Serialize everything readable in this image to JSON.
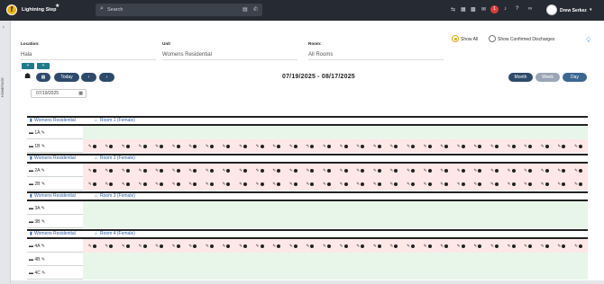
{
  "app": {
    "brand": "Lightning Step",
    "star": "★"
  },
  "search": {
    "placeholder": "Search"
  },
  "topbar": {
    "badge_count": "1",
    "user_name": "Drew Serkez"
  },
  "sidebar": {
    "arrow": "‹",
    "vertical_label": "HOMEPAGE"
  },
  "filters": {
    "location_label": "Location:",
    "location_value": "Hala",
    "unit_label": "Unit",
    "unit_value": "Womens Residential",
    "room_label": "Room:",
    "room_value": "All Rooms",
    "show_all": "Show All",
    "show_confirmed": "Show Confirmed Discharges",
    "selected": "show_all"
  },
  "add_buttons": [
    "+",
    "+"
  ],
  "toolbar": {
    "today": "Today",
    "prev": "‹",
    "next": "›",
    "range": "07/19/2025 - 08/17/2025",
    "views": [
      "Month",
      "Week",
      "Day"
    ],
    "active_view": "Month",
    "date_input": "07/19/2025"
  },
  "units": [
    {
      "unit": "Womens Residential",
      "room": "Room 1 (Female)",
      "beds": [
        {
          "label": "1A",
          "occupied": false
        },
        {
          "label": "1B",
          "occupied": true
        }
      ]
    },
    {
      "unit": "Womens Residential",
      "room": "Room 2 (Female)",
      "beds": [
        {
          "label": "2A",
          "occupied": true
        },
        {
          "label": "2B",
          "occupied": true
        }
      ]
    },
    {
      "unit": "Womens Residential",
      "room": "Room 3 (Female)",
      "beds": [
        {
          "label": "3A",
          "occupied": false
        },
        {
          "label": "3B",
          "occupied": false
        }
      ]
    },
    {
      "unit": "Womens Residential",
      "room": "Room 4 (Female)",
      "beds": [
        {
          "label": "4A",
          "occupied": true
        },
        {
          "label": "4B",
          "occupied": false
        },
        {
          "label": "4C",
          "occupied": false
        }
      ]
    }
  ],
  "colors": {
    "topbar": "#262b33",
    "teal": "#1f7a8c",
    "navy": "#2e4a6b",
    "occupied": "#fde7e7",
    "free": "#e8f6ea",
    "badge": "#e03c3c"
  }
}
